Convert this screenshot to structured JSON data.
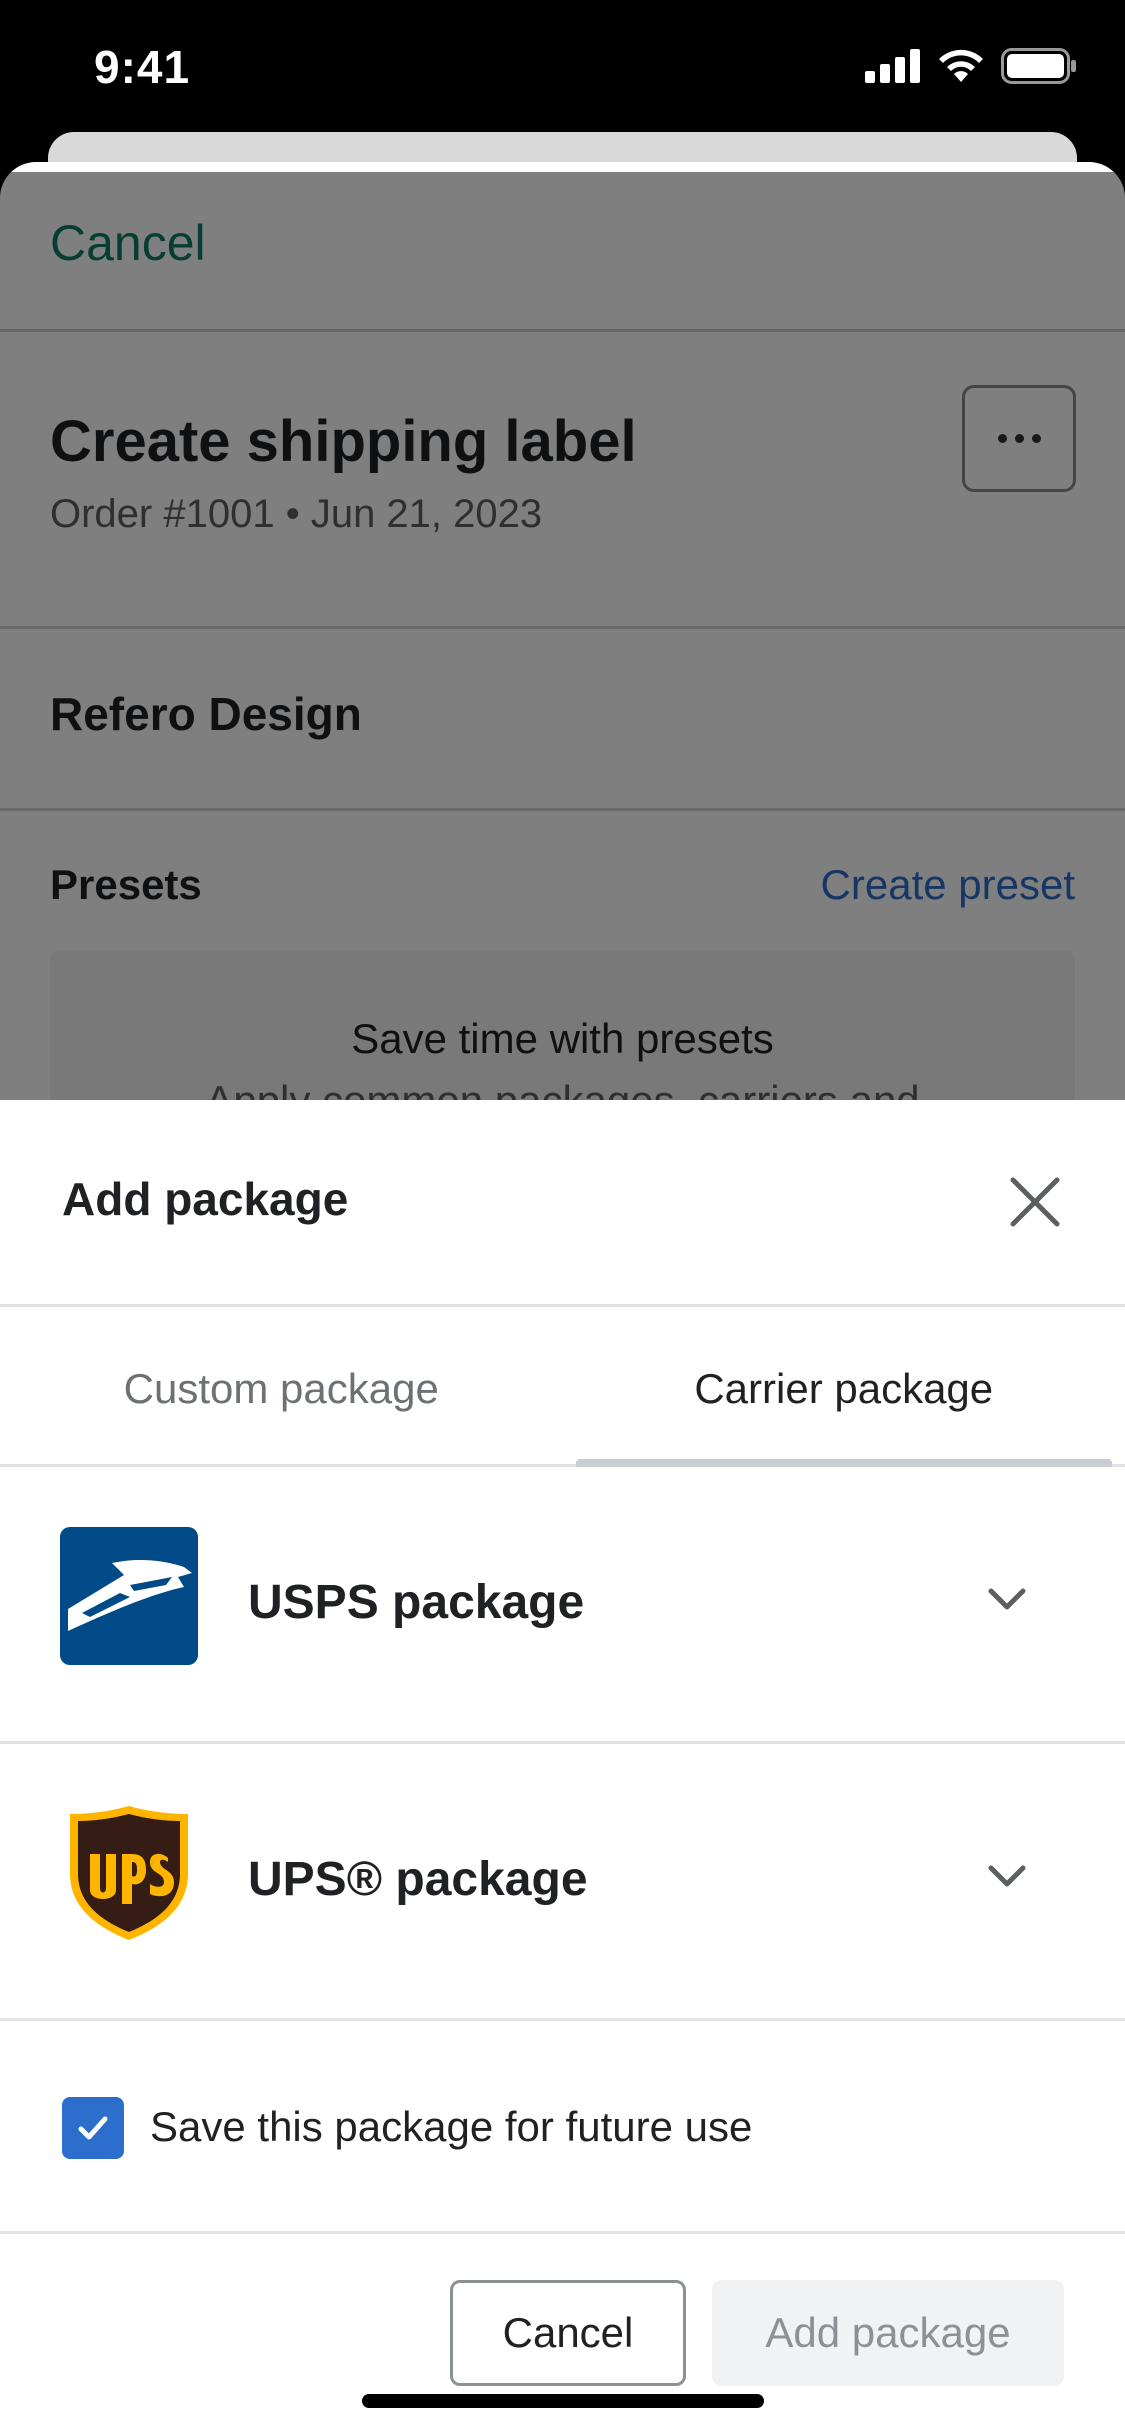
{
  "status_bar": {
    "time": "9:41"
  },
  "sheet": {
    "cancel_label": "Cancel",
    "title": "Create shipping label",
    "subtitle": "Order #1001 • Jun 21, 2023",
    "store_name": "Refero Design",
    "presets_label": "Presets",
    "create_preset_label": "Create preset",
    "presets_box_heading": "Save time with presets",
    "presets_box_text": "Apply common packages, carriers and"
  },
  "modal": {
    "title": "Add package",
    "tabs": [
      {
        "label": "Custom package",
        "active": false
      },
      {
        "label": "Carrier package",
        "active": true
      }
    ],
    "packages": [
      {
        "label": "USPS package",
        "logo": "usps-logo"
      },
      {
        "label": "UPS® package",
        "logo": "ups-logo"
      }
    ],
    "save_checkbox": {
      "label": "Save this package for future use",
      "checked": true
    },
    "cancel_button": "Cancel",
    "add_button": "Add package"
  },
  "colors": {
    "accent_green": "#0d7e64",
    "link_blue": "#2c6ecb",
    "usps_blue": "#004b87",
    "ups_brown": "#351c15",
    "ups_gold": "#ffb500"
  }
}
